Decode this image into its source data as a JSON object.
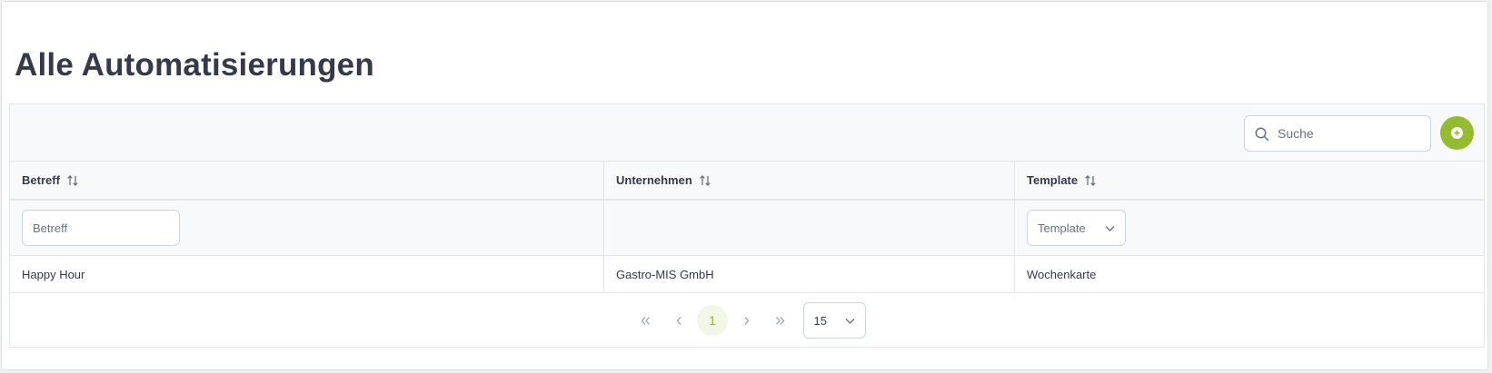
{
  "page": {
    "title": "Alle Automatisierungen"
  },
  "toolbar": {
    "search_placeholder": "Suche",
    "add_icon": "plus-circle-icon",
    "accent_color": "#95bb2e"
  },
  "table": {
    "columns": [
      {
        "label": "Betreff",
        "sort_icon": "sort-icon"
      },
      {
        "label": "Unternehmen",
        "sort_icon": "sort-icon"
      },
      {
        "label": "Template",
        "sort_icon": "sort-icon"
      }
    ],
    "filters": {
      "betreff_placeholder": "Betreff",
      "template_placeholder": "Template"
    },
    "rows": [
      {
        "betreff": "Happy Hour",
        "unternehmen": "Gastro-MIS GmbH",
        "template": "Wochenkarte"
      }
    ]
  },
  "pagination": {
    "current_page": "1",
    "rows_per_page": "15"
  }
}
